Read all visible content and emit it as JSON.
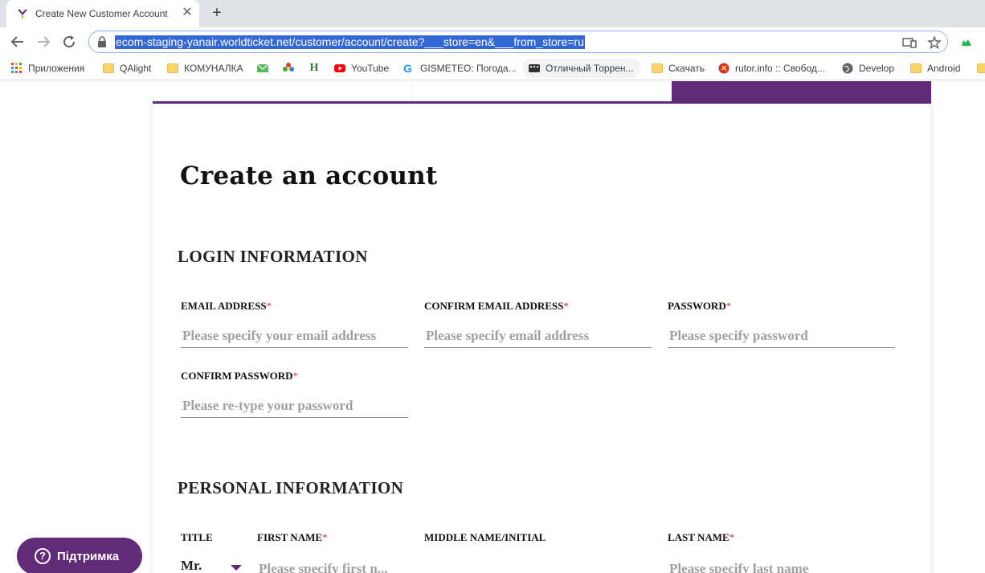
{
  "browser": {
    "tab": {
      "title": "Create New Customer Account",
      "close_glyph": "✕"
    },
    "new_tab_glyph": "+",
    "url": "ecom-staging-yanair.worldticket.net/customer/account/create?___store=en&___from_store=ru",
    "bookmarks": [
      {
        "label": "Приложения",
        "icon": "apps-grid-icon"
      },
      {
        "label": "QAlight",
        "icon": "folder-icon"
      },
      {
        "label": "КОМУНАЛКА",
        "icon": "folder-icon"
      },
      {
        "label": "",
        "icon": "mail-icon"
      },
      {
        "label": "",
        "icon": "star-flower-icon"
      },
      {
        "label": "",
        "icon": "h-letter-icon"
      },
      {
        "label": "YouTube",
        "icon": "youtube-icon"
      },
      {
        "label": "GISMETEO: Погода...",
        "icon": "gismeteo-icon"
      },
      {
        "label": "Отличный Торрен...",
        "icon": "film-icon"
      },
      {
        "label": "Скачать",
        "icon": "folder-icon"
      },
      {
        "label": "rutor.info :: Свобод...",
        "icon": "rutor-icon"
      },
      {
        "label": "Develop",
        "icon": "globe-icon"
      },
      {
        "label": "Android",
        "icon": "folder-icon"
      }
    ]
  },
  "page": {
    "title": "Create an account",
    "login_section": {
      "title": "LOGIN INFORMATION",
      "email": {
        "label": "EMAIL ADDRESS",
        "required": "*",
        "placeholder": "Please specify your email address"
      },
      "confirm_email": {
        "label": "CONFIRM EMAIL ADDRESS",
        "required": "*",
        "placeholder": "Please specify email address"
      },
      "password": {
        "label": "PASSWORD",
        "required": "*",
        "placeholder": "Please specify password"
      },
      "confirm_password": {
        "label": "CONFIRM PASSWORD",
        "required": "*",
        "placeholder": "Please re-type your password"
      }
    },
    "personal_section": {
      "title": "PERSONAL INFORMATION",
      "title_field": {
        "label": "TITLE",
        "value": "Mr."
      },
      "first_name": {
        "label": "FIRST NAME",
        "required": "*",
        "placeholder": "Please specify first n..."
      },
      "middle_name": {
        "label": "MIDDLE NAME/INITIAL",
        "placeholder": ""
      },
      "last_name": {
        "label": "LAST NAME",
        "required": "*",
        "placeholder": "Please specify last name"
      }
    },
    "support_button": {
      "label": "Підтримка",
      "icon_glyph": "?"
    }
  },
  "colors": {
    "brand_purple": "#612b7a",
    "url_highlight": "#3367d6",
    "required": "#c0392b"
  }
}
